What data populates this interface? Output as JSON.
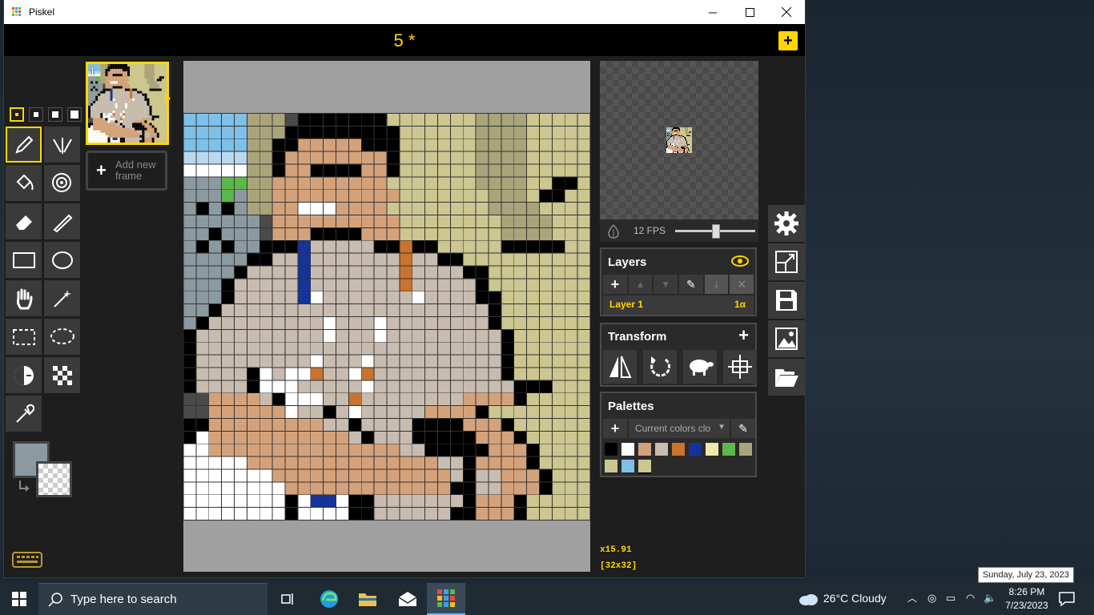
{
  "window": {
    "title": "Piskel",
    "minimize": "—",
    "maximize": "☐",
    "close": "✕"
  },
  "header": {
    "document_title": "5 *",
    "new_button": "+"
  },
  "frames": {
    "frame_number": "1",
    "add_label": "Add new frame"
  },
  "preview": {
    "fps_label": "12 FPS",
    "fps_value": 12
  },
  "layers": {
    "title": "Layers",
    "items": [
      {
        "name": "Layer 1",
        "opacity": "1α"
      }
    ]
  },
  "transform": {
    "title": "Transform",
    "add": "+"
  },
  "palettes": {
    "title": "Palettes",
    "current": "Current colors clo",
    "colors": [
      "#000000",
      "#ffffff",
      "#d4a27a",
      "#c8bcb0",
      "#c8732e",
      "#15339a",
      "#f0e8a8",
      "#5cb84a",
      "#a9a47a",
      "#ccc690",
      "#7ec0e8"
    ]
  },
  "status": {
    "zoom": "x15.91",
    "size": "[32x32]"
  },
  "pixel_art": {
    "palette": {
      "0": "#000000",
      "1": "#ffffff",
      "2": "#d4a27a",
      "3": "#c8bcb0",
      "4": "#c8732e",
      "5": "#15339a",
      "6": "#ccc690",
      "7": "#a9a47a",
      "8": "#7ec0e8",
      "9": "#5cb84a",
      "a": "#8a9aa0",
      "b": "#4a4a4a",
      "c": "#b8d8ee"
    },
    "rows": [
      "88888777b0000000666666677776666",
      "8888877700000000066666677776666",
      "8888877002222200066666677776666",
      "ccccc77022222222066666677776666",
      "1111177022000022066666677776666",
      "aaa9977222222222666666677776600",
      "aaa9a7722222222226666666777600",
      "a0a0a772211122226666666677776666",
      "aaaaaab22222222226666666677776666",
      "aa0aaab22200002226666666677776666",
      "a0a0aa0005333330040066666000006666",
      "aaaaa0033533333334330066666666666",
      "aaaa03333533333334333300666666666",
      "aaa033333533333334333330666666666",
      "aaa033333513333333133330066666666",
      "aa0333333333333333333333066666666",
      "a03333333331333133333333066666666",
      "0333333333313331333333333066666666",
      "0333333333333333333333333066666666",
      "03333333331333133333333330666666",
      "033330131143314333333333306666666",
      "0333301113333313333333333300066666",
      "bb2222301113343333333322220666666",
      "bb2222221330313333322220666666",
      "002222222223303333000022206666666",
      "0122222222222303330000022206666666",
      "1122222222222222233000002220666666",
      "1111122222222222222233022220666666",
      "1111111222222222222223033222066666",
      "1111111122222222222220033222066666",
      "1111111101551003333333022206666666",
      "1111111101111003333330022206666666"
    ]
  }
}
